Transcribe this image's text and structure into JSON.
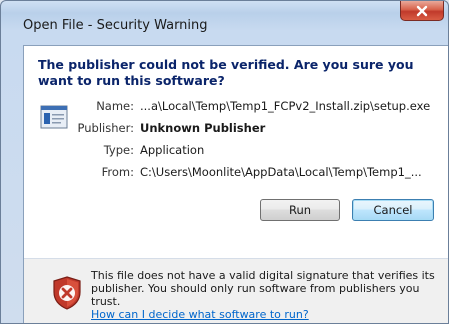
{
  "window": {
    "title": "Open File - Security Warning",
    "close_label": "x"
  },
  "headline": "The publisher could not be verified.  Are you sure you want to run this software?",
  "details": {
    "name_label": "Name:",
    "name_value": "...a\\Local\\Temp\\Temp1_FCPv2_Install.zip\\setup.exe",
    "publisher_label": "Publisher:",
    "publisher_value": "Unknown Publisher",
    "type_label": "Type:",
    "type_value": "Application",
    "from_label": "From:",
    "from_value": "C:\\Users\\Moonlite\\AppData\\Local\\Temp\\Temp1_..."
  },
  "buttons": {
    "run": "Run",
    "cancel": "Cancel"
  },
  "footer": {
    "line1": "This file does not have a valid digital signature that verifies its",
    "line2": "publisher.  You should only run software from publishers you trust.",
    "link": "How can I decide what software to run?"
  },
  "icons": {
    "close": "close-icon",
    "file": "application-file-icon",
    "warning": "security-shield-icon"
  },
  "colors": {
    "headline": "#0a246a",
    "link": "#0066cc",
    "close": "#c0392b",
    "shield": "#c0392b"
  }
}
